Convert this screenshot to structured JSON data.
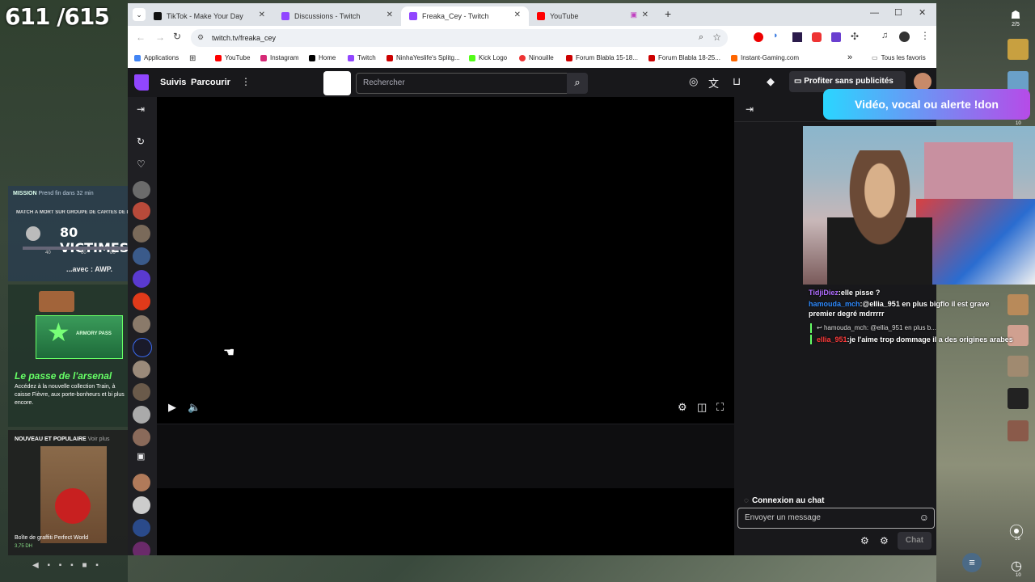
{
  "overlay": {
    "score": "611 /615",
    "mission": {
      "header_left": "MISSION",
      "header_right": "Prend fin dans 32 min",
      "subtitle": "MATCH À MORT SUR GROUPE DE CARTES DE LA COMMU",
      "count": "80 VICTIMES",
      "ticks": [
        "40",
        "60",
        "80"
      ],
      "avec": "...avec : AWP."
    },
    "arsenal": {
      "title": "Le passe de l'arsenal",
      "badge": "ARMORY PASS",
      "description": "Accédez à la nouvelle collection Train, à caisse Fièvre, aux porte-bonheurs et bi plus encore."
    },
    "graffiti": {
      "header": "NOUVEAU ET POPULAIRE",
      "header_tag": "Voir plus",
      "name": "Boîte de graffiti Perfect World",
      "price": "3,75 DH"
    },
    "pager": "◀ ▪ ▪ ▪ ■ ▪",
    "right_top_count": "2/5",
    "right_bottom_1": "16",
    "right_bottom_2": "10",
    "right_count_10": "10",
    "alert": "Vidéo, vocal ou alerte !don",
    "chat_overlay": [
      {
        "user": "TidjiDiez",
        "text": ":elle pisse ?",
        "color": "#b06cff"
      },
      {
        "user": "hamouda_mch",
        "text": ":@ellia_951 en plus bigflo il est grave premier degré mdrrrrr",
        "color": "#2e8bff"
      },
      {
        "reply": "hamouda_mch: @ellia_951 en plus b..."
      },
      {
        "user": "ellia_951",
        "text": ":je l'aime trop dommage il a des origines arabes",
        "color": "#ff3b3b"
      }
    ]
  },
  "browser": {
    "tabs": [
      {
        "label": "TikTok - Make Your Day",
        "icon": "tiktok-icon",
        "color": "#111"
      },
      {
        "label": "Discussions - Twitch",
        "icon": "twitch-icon",
        "color": "#9146ff"
      },
      {
        "label": "Freaka_Cey - Twitch",
        "icon": "twitch-icon",
        "color": "#9146ff",
        "active": true
      },
      {
        "label": "YouTube",
        "icon": "youtube-icon",
        "color": "#ff0000"
      }
    ],
    "url": "twitch.tv/freaka_cey",
    "bookmarks": [
      {
        "label": "Applications",
        "color": "#4285f4"
      },
      {
        "label": "YouTube",
        "color": "#ff0000"
      },
      {
        "label": "Instagram",
        "color": "#d62976"
      },
      {
        "label": "Home",
        "color": "#000"
      },
      {
        "label": "Twitch",
        "color": "#9146ff"
      },
      {
        "label": "NinhaYeslife's Splitg...",
        "color": "#c00"
      },
      {
        "label": "Kick Logo",
        "color": "#53fc18"
      },
      {
        "label": "Ninouille",
        "color": "#e33"
      },
      {
        "label": "Forum Blabla 15-18...",
        "color": "#c00"
      },
      {
        "label": "Forum Blabla 18-25...",
        "color": "#c00"
      },
      {
        "label": "Instant-Gaming.com",
        "color": "#f60"
      }
    ],
    "bookmarks_more": "»",
    "all_bookmarks": "Tous les favoris"
  },
  "twitch": {
    "nav_following": "Suivis",
    "nav_browse": "Parcourir",
    "search_placeholder": "Rechercher",
    "turbo": "Profiter sans publicités",
    "chat_connecting": "Connexion au chat",
    "chat_input_placeholder": "Envoyer un message",
    "chat_button": "Chat",
    "accent": "#9146ff"
  }
}
